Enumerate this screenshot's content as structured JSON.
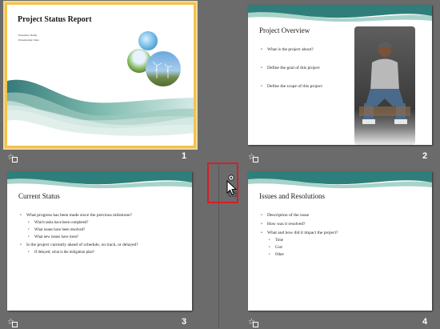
{
  "slides": [
    {
      "number": "1",
      "title": "Project Status Report",
      "lines": [
        "Presenter: Name",
        "Presentation: Date"
      ]
    },
    {
      "number": "2",
      "title": "Project Overview",
      "bullets": [
        "What is the project about?",
        "Define the goal of this project",
        "Define the scope of this project"
      ]
    },
    {
      "number": "3",
      "title": "Current Status",
      "bullets": [
        {
          "text": "What progress has been made since the previous milestone?",
          "sub": [
            "Which tasks have been completed?",
            "What issues have been resolved?",
            "What new issues have risen?"
          ]
        },
        {
          "text": "Is the project currently ahead of schedule, on track, or delayed?",
          "sub": [
            "If delayed, what is the mitigation plan?"
          ]
        }
      ]
    },
    {
      "number": "4",
      "title": "Issues and Resolutions",
      "bullets": [
        {
          "text": "Description of the issue",
          "sub": []
        },
        {
          "text": "How was it resolved?",
          "sub": []
        },
        {
          "text": "What and how did it impact the project?",
          "sub": [
            "Time",
            "Cost",
            "Other"
          ]
        }
      ]
    }
  ],
  "icons": {
    "transition": "star-icon",
    "cursor": "move-cursor-icon"
  },
  "colors": {
    "background": "#6b6b6b",
    "selection": "#f4c24a",
    "drop_highlight": "#d51f26",
    "wave_teal": "#3f8f8a"
  }
}
